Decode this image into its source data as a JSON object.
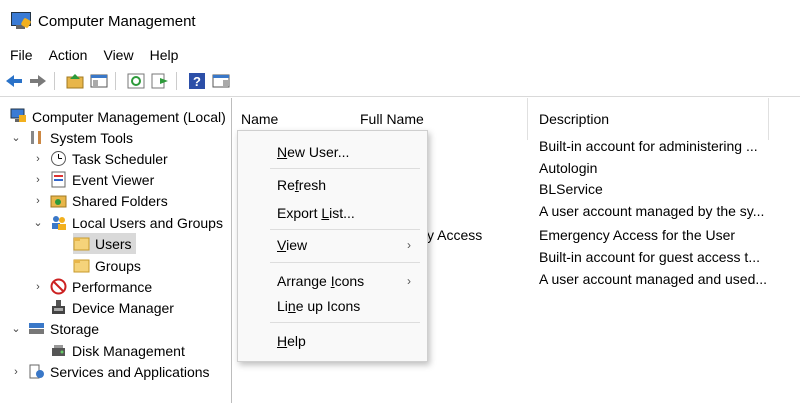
{
  "window": {
    "title": "Computer Management"
  },
  "menu": {
    "items": [
      "File",
      "Action",
      "View",
      "Help"
    ]
  },
  "toolbar": {
    "buttons": [
      "back-icon",
      "forward-icon",
      "up-folder-icon",
      "show-hide-tree-icon",
      "refresh-icon",
      "export-list-icon",
      "help-icon",
      "show-action-pane-icon"
    ]
  },
  "tree": {
    "items": [
      {
        "label": "Computer Management (Local)",
        "icon": "computer-management-icon"
      },
      {
        "label": "System Tools",
        "icon": "tools-icon"
      },
      {
        "label": "Task Scheduler",
        "icon": "clock-icon"
      },
      {
        "label": "Event Viewer",
        "icon": "event-viewer-icon"
      },
      {
        "label": "Shared Folders",
        "icon": "shared-folder-icon"
      },
      {
        "label": "Local Users and Groups",
        "icon": "users-icon"
      },
      {
        "label": "Users",
        "icon": "folder-icon",
        "selected": true
      },
      {
        "label": "Groups",
        "icon": "folder-icon"
      },
      {
        "label": "Performance",
        "icon": "performance-icon"
      },
      {
        "label": "Device Manager",
        "icon": "device-manager-icon"
      },
      {
        "label": "Storage",
        "icon": "storage-icon"
      },
      {
        "label": "Disk Management",
        "icon": "disk-icon"
      },
      {
        "label": "Services and Applications",
        "icon": "services-icon"
      }
    ]
  },
  "list": {
    "columns": [
      "Name",
      "Full Name",
      "Description"
    ],
    "rows": [
      {
        "fullname": "",
        "description": "Built-in account for administering ..."
      },
      {
        "fullname": "",
        "description": "Autologin"
      },
      {
        "fullname": "",
        "description": "BLService"
      },
      {
        "fullname": "",
        "description": "A user account managed by the sy..."
      },
      {
        "fullname": "y Access",
        "description": "Emergency Access for the User"
      },
      {
        "fullname": "",
        "description": "Built-in account for guest access t..."
      },
      {
        "fullname": "",
        "description": "A user account managed and used..."
      }
    ]
  },
  "context_menu": {
    "items": [
      {
        "pre": "",
        "u": "N",
        "post": "ew User...",
        "submenu": false
      },
      {
        "pre": "Re",
        "u": "f",
        "post": "resh",
        "submenu": false
      },
      {
        "pre": "Export ",
        "u": "L",
        "post": "ist...",
        "submenu": false
      },
      {
        "pre": "",
        "u": "V",
        "post": "iew",
        "submenu": true
      },
      {
        "pre": "Arrange ",
        "u": "I",
        "post": "cons",
        "submenu": true
      },
      {
        "pre": "Li",
        "u": "n",
        "post": "e up Icons",
        "submenu": false
      },
      {
        "pre": "",
        "u": "H",
        "post": "elp",
        "submenu": false
      }
    ]
  }
}
